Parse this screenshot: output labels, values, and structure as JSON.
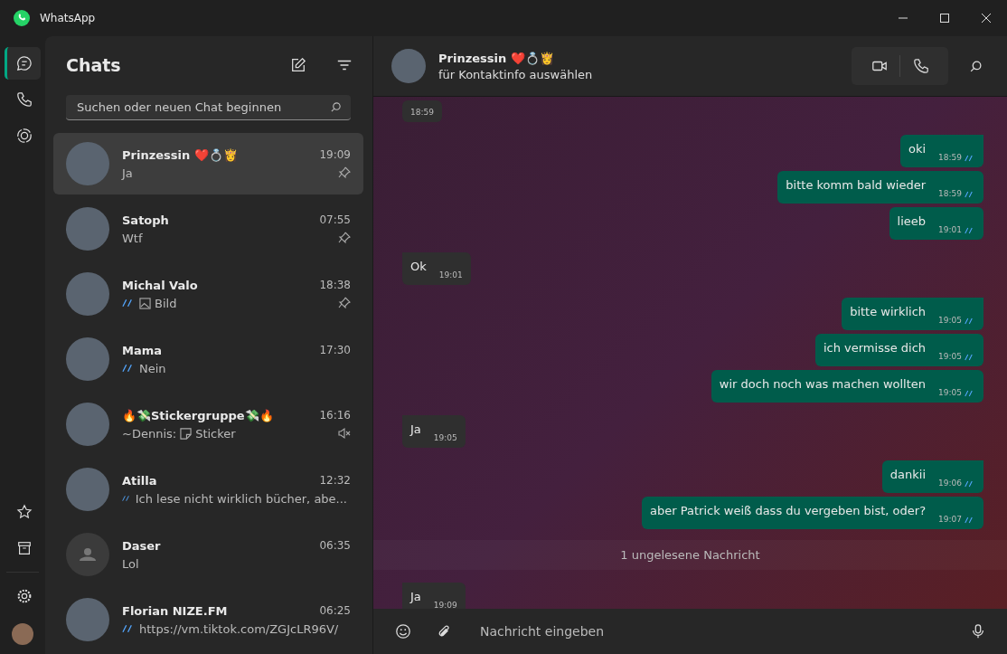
{
  "window": {
    "title": "WhatsApp"
  },
  "nav": {
    "items": [
      {
        "kind": "chats",
        "selected": true
      },
      {
        "kind": "calls",
        "selected": false
      },
      {
        "kind": "status",
        "selected": false
      }
    ]
  },
  "chat_list": {
    "title": "Chats",
    "search": {
      "placeholder": "Suchen oder neuen Chat beginnen"
    },
    "chats": [
      {
        "name": "Prinzessin ❤️💍👸",
        "time": "19:09",
        "preview": "Ja",
        "read": false,
        "image": false,
        "sticker": false,
        "pinned": true,
        "muted": false,
        "selected": true,
        "default_avatar": false
      },
      {
        "name": "Satoph",
        "time": "07:55",
        "preview": "Wtf",
        "read": false,
        "image": false,
        "sticker": false,
        "pinned": true,
        "muted": false,
        "selected": false,
        "default_avatar": false
      },
      {
        "name": "Michal Valo",
        "time": "18:38",
        "preview": "Bild",
        "read": true,
        "image": true,
        "sticker": false,
        "pinned": true,
        "muted": false,
        "selected": false,
        "default_avatar": false
      },
      {
        "name": "Mama",
        "time": "17:30",
        "preview": "Nein",
        "read": true,
        "image": false,
        "sticker": false,
        "pinned": false,
        "muted": false,
        "selected": false,
        "default_avatar": false
      },
      {
        "name": "🔥💸Stickergruppe💸🔥",
        "time": "16:16",
        "sender": "~Dennis:",
        "preview": "Sticker",
        "read": false,
        "image": false,
        "sticker": true,
        "pinned": false,
        "muted": true,
        "selected": false,
        "default_avatar": false
      },
      {
        "name": "Atilla",
        "time": "12:32",
        "preview": "Ich lese nicht wirklich bücher, abe...",
        "read": true,
        "image": false,
        "sticker": false,
        "pinned": false,
        "muted": false,
        "selected": false,
        "default_avatar": false
      },
      {
        "name": "Daser",
        "time": "06:35",
        "preview": "Lol",
        "read": false,
        "image": false,
        "sticker": false,
        "pinned": false,
        "muted": false,
        "selected": false,
        "default_avatar": true
      },
      {
        "name": "Florian NIZE.FM",
        "time": "06:25",
        "preview": "https://vm.tiktok.com/ZGJcLR96V/",
        "read": true,
        "image": false,
        "sticker": false,
        "pinned": false,
        "muted": false,
        "selected": false,
        "default_avatar": false
      }
    ]
  },
  "conversation": {
    "name": "Prinzessin ❤️💍👸",
    "subtitle": "für Kontaktinfo auswählen",
    "messages": [
      {
        "kind": "in",
        "time": "18:59",
        "tail": false
      },
      {
        "kind": "out",
        "text": "oki",
        "time": "18:59",
        "tail": true
      },
      {
        "kind": "out",
        "text": "bitte komm bald wieder",
        "time": "18:59",
        "tail": false
      },
      {
        "kind": "out",
        "text": "lieeb",
        "time": "19:01",
        "tail": false
      },
      {
        "kind": "in",
        "text": "Ok",
        "time": "19:01",
        "tail": true
      },
      {
        "kind": "out",
        "text": "bitte wirklich",
        "time": "19:05",
        "tail": true
      },
      {
        "kind": "out",
        "text": "ich vermisse dich",
        "time": "19:05",
        "tail": false
      },
      {
        "kind": "out",
        "text": "wir doch noch was machen wollten",
        "time": "19:05",
        "tail": false
      },
      {
        "kind": "in",
        "text": "Ja",
        "time": "19:05",
        "tail": true
      },
      {
        "kind": "out",
        "text": "dankii",
        "time": "19:06",
        "tail": true
      },
      {
        "kind": "out",
        "text": "aber Patrick weiß dass du vergeben bist, oder?",
        "time": "19:07",
        "tail": false
      },
      {
        "kind": "divider",
        "text": "1 ungelesene Nachricht"
      },
      {
        "kind": "in",
        "text": "Ja",
        "time": "19:09",
        "tail": true
      }
    ],
    "composer": {
      "placeholder": "Nachricht eingeben"
    }
  }
}
